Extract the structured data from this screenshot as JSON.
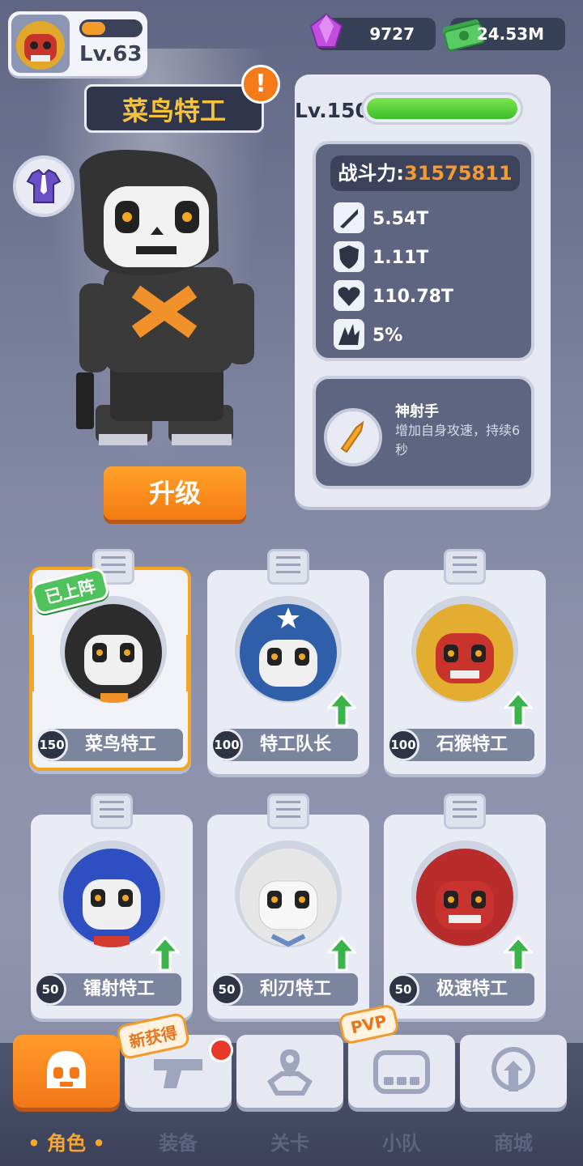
{
  "player": {
    "level": "Lv.63",
    "xp_fraction": 0.4
  },
  "currency": {
    "gems": "9727",
    "cash": "24.53M"
  },
  "hero": {
    "name": "菜鸟特工",
    "level": "Lv.150",
    "hp_fraction": 1.0,
    "power_label": "战斗力:",
    "power_value": "31575811",
    "stats": {
      "attack": "5.54T",
      "defense": "1.11T",
      "health": "110.78T",
      "crit": "5%"
    },
    "skill": {
      "name": "神射手",
      "desc": "增加自身攻速，持续6秒"
    },
    "upgrade_label": "升级"
  },
  "deployed_label": "已上阵",
  "cards": [
    {
      "level": "150",
      "name": "菜鸟特工"
    },
    {
      "level": "100",
      "name": "特工队长"
    },
    {
      "level": "100",
      "name": "石猴特工"
    },
    {
      "level": "50",
      "name": "镭射特工"
    },
    {
      "level": "50",
      "name": "利刃特工"
    },
    {
      "level": "50",
      "name": "极速特工"
    }
  ],
  "nav": {
    "items": [
      "角色",
      "装备",
      "关卡",
      "小队",
      "商城"
    ],
    "new_tag": "新获得",
    "pvp_tag": "PVP"
  },
  "colors": {
    "accent": "#f47b12",
    "panel": "#5d6580",
    "power_value": "#f59a33",
    "green": "#3cbd2a"
  }
}
